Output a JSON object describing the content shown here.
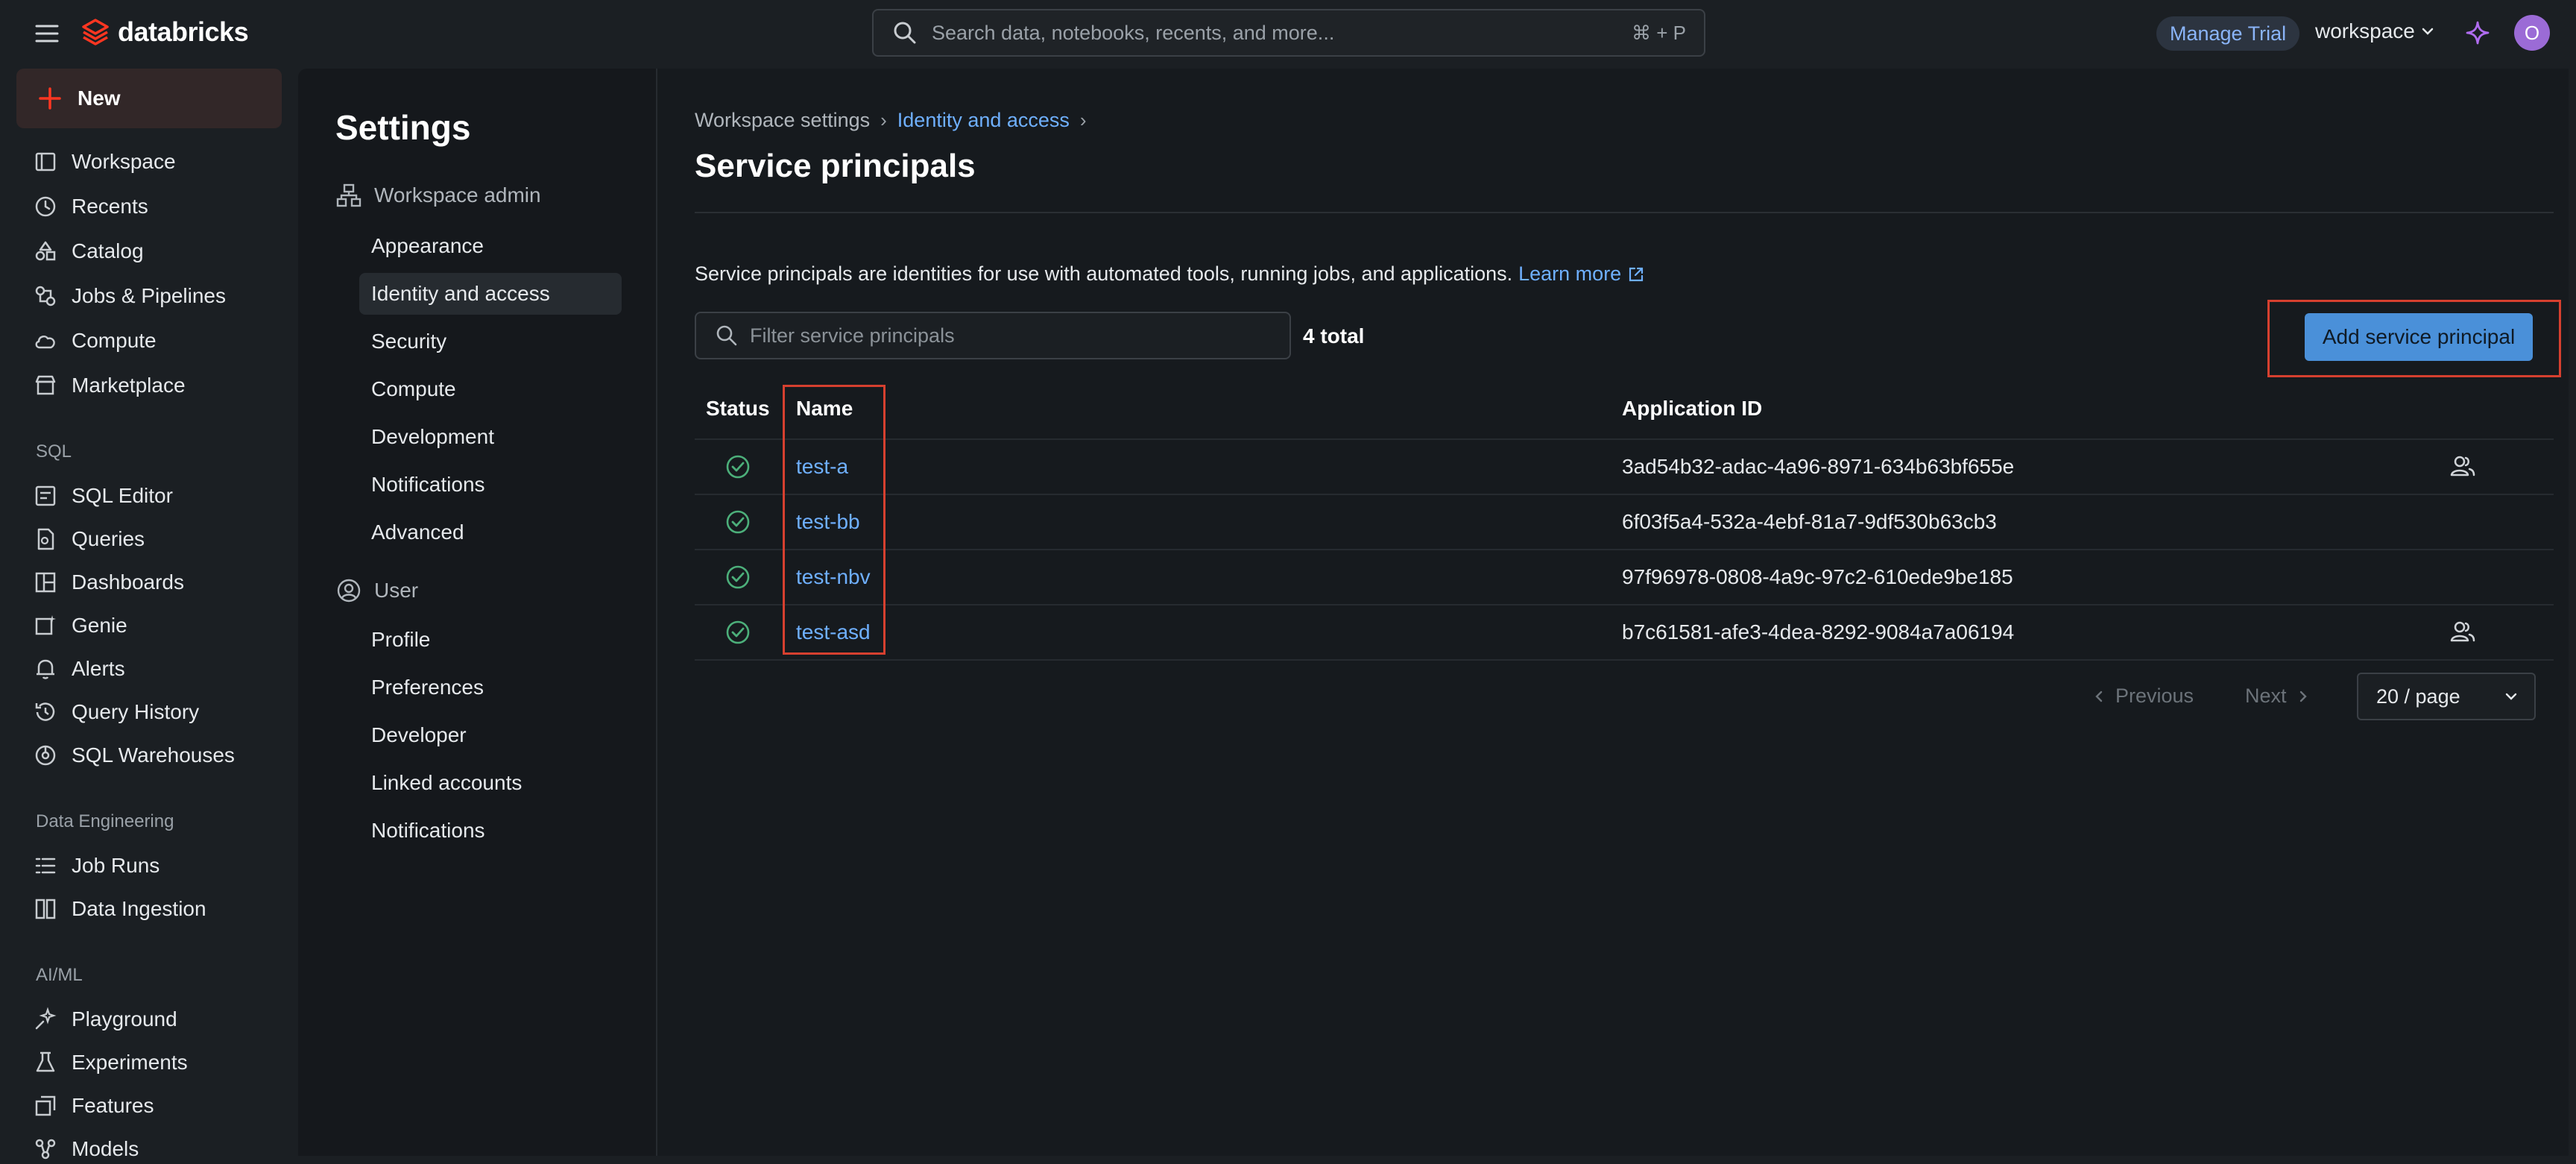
{
  "topbar": {
    "brand": "databricks",
    "search_placeholder": "Search data, notebooks, recents, and more...",
    "search_shortcut": "⌘ + P",
    "manage_trial": "Manage Trial",
    "workspace": "workspace",
    "avatar_initial": "O"
  },
  "leftnav": {
    "new_label": "New",
    "items": [
      {
        "label": "Workspace",
        "icon": "workspace-icon"
      },
      {
        "label": "Recents",
        "icon": "clock-icon"
      },
      {
        "label": "Catalog",
        "icon": "catalog-icon"
      },
      {
        "label": "Jobs & Pipelines",
        "icon": "jobs-icon"
      },
      {
        "label": "Compute",
        "icon": "cloud-icon"
      },
      {
        "label": "Marketplace",
        "icon": "store-icon"
      }
    ],
    "sql_section": "SQL",
    "sql_items": [
      {
        "label": "SQL Editor",
        "icon": "sql-editor-icon"
      },
      {
        "label": "Queries",
        "icon": "query-icon"
      },
      {
        "label": "Dashboards",
        "icon": "dashboard-icon"
      },
      {
        "label": "Genie",
        "icon": "genie-icon"
      },
      {
        "label": "Alerts",
        "icon": "bell-icon"
      },
      {
        "label": "Query History",
        "icon": "history-icon"
      },
      {
        "label": "SQL Warehouses",
        "icon": "warehouse-icon"
      }
    ],
    "de_section": "Data Engineering",
    "de_items": [
      {
        "label": "Job Runs",
        "icon": "job-runs-icon"
      },
      {
        "label": "Data Ingestion",
        "icon": "ingestion-icon"
      }
    ],
    "ml_section": "AI/ML",
    "ml_items": [
      {
        "label": "Playground",
        "icon": "playground-icon"
      },
      {
        "label": "Experiments",
        "icon": "experiment-icon"
      },
      {
        "label": "Features",
        "icon": "features-icon"
      },
      {
        "label": "Models",
        "icon": "models-icon"
      }
    ]
  },
  "settings": {
    "title": "Settings",
    "workspace_admin": "Workspace admin",
    "admin_items": [
      "Appearance",
      "Identity and access",
      "Security",
      "Compute",
      "Development",
      "Notifications",
      "Advanced"
    ],
    "user_group": "User",
    "user_items": [
      "Profile",
      "Preferences",
      "Developer",
      "Linked accounts",
      "Notifications"
    ]
  },
  "content": {
    "breadcrumb": [
      "Workspace settings",
      "Identity and access"
    ],
    "title": "Service principals",
    "description": "Service principals are identities for use with automated tools, running jobs, and applications.",
    "learn_more": "Learn more",
    "filter_placeholder": "Filter service principals",
    "total": "4 total",
    "add_button": "Add service principal",
    "columns": [
      "Status",
      "Name",
      "Application ID"
    ],
    "rows": [
      {
        "name": "test-a",
        "app_id": "3ad54b32-adac-4a96-8971-634b63bf655e",
        "action": true
      },
      {
        "name": "test-bb",
        "app_id": "6f03f5a4-532a-4ebf-81a7-9df530b63cb3",
        "action": false
      },
      {
        "name": "test-nbv",
        "app_id": "97f96978-0808-4a9c-97c2-610ede9be185",
        "action": false
      },
      {
        "name": "test-asd",
        "app_id": "b7c61581-afe3-4dea-8292-9084a7a06194",
        "action": true
      }
    ],
    "pagination": {
      "previous": "Previous",
      "next": "Next",
      "page_size": "20 / page"
    }
  },
  "colors": {
    "accent": "#4a90d9",
    "link": "#6fb0ff",
    "highlight": "#d6402f",
    "status_ok": "#4caf7a"
  }
}
